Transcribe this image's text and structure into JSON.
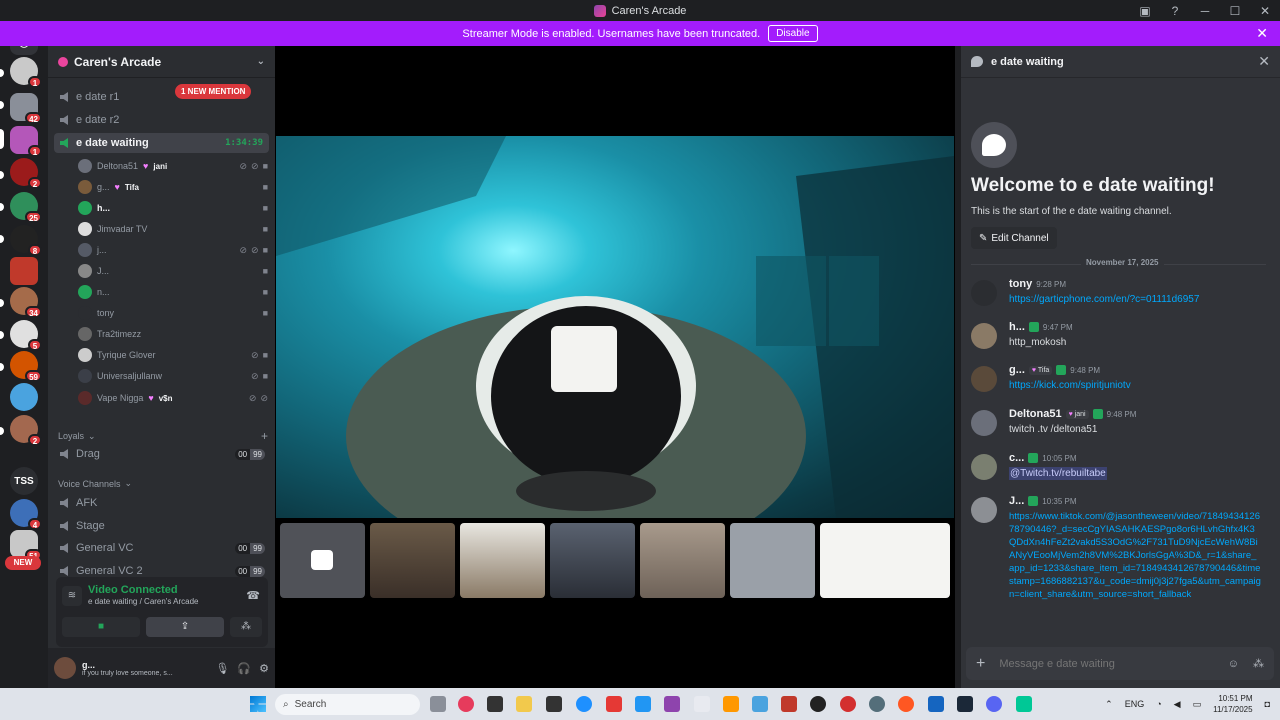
{
  "window": {
    "title": "Caren's Arcade"
  },
  "banner": {
    "text": "Streamer Mode is enabled. Usernames have been truncated.",
    "button": "Disable"
  },
  "guilds": {
    "badges": [
      "1",
      "42",
      "1",
      "2",
      "25",
      "8",
      "34",
      "5",
      "59",
      "2",
      "4",
      "51"
    ],
    "tss_label": "TSS",
    "new_label": "NEW"
  },
  "server": {
    "name": "Caren's Arcade"
  },
  "channels": {
    "r1": "e date r1",
    "mention": "1 NEW MENTION",
    "r2": "e date r2",
    "active": "e date waiting",
    "active_timer": "1:34:39"
  },
  "voice_users": [
    {
      "name": "Deltona51",
      "tag": "jani",
      "heart": true
    },
    {
      "name": "g...",
      "tag": "Tifa",
      "heart": true
    },
    {
      "name": "h...",
      "live": true
    },
    {
      "name": "Jimvadar TV"
    },
    {
      "name": "j..."
    },
    {
      "name": "J..."
    },
    {
      "name": "n..."
    },
    {
      "name": "tony"
    },
    {
      "name": "Tra2timezz"
    },
    {
      "name": "Tyrique Glover"
    },
    {
      "name": "Universaljullanw"
    },
    {
      "name": "Vape Nigga",
      "tag": "v$n",
      "heart": true
    }
  ],
  "categories": {
    "loyals": "Loyals",
    "drag": "Drag",
    "drag_count": [
      "00",
      "99"
    ],
    "voice": "Voice Channels",
    "afk": "AFK",
    "stage": "Stage",
    "general": "General VC",
    "general_count": [
      "00",
      "99"
    ],
    "general2": "General VC 2",
    "general2_count": [
      "00",
      "99"
    ]
  },
  "voice_panel": {
    "status": "Video Connected",
    "channel": "e date waiting / Caren's Arcade"
  },
  "user_panel": {
    "name": "g...",
    "status": "if you truly love someone, s..."
  },
  "chat": {
    "header": "e date waiting",
    "welcome_title": "Welcome to e date waiting!",
    "welcome_sub": "This is the start of the e date waiting channel.",
    "edit_button": "Edit Channel",
    "date_divider": "November 17, 2025",
    "messages": [
      {
        "author": "tony",
        "time": "9:28 PM",
        "body": "https://garticphone.com/en/?c=01111d6957"
      },
      {
        "author": "h...",
        "time": "9:47 PM",
        "body": "http_mokosh"
      },
      {
        "author": "g...",
        "tag": "Tifa",
        "time": "9:48 PM",
        "body": "https://kick.com/spiritjuniotv"
      },
      {
        "author": "Deltona51",
        "tag": "jani",
        "time": "9:48 PM",
        "body": "twitch .tv /deltona51"
      },
      {
        "author": "c...",
        "time": "10:05 PM",
        "body": "@Twitch.tv/rebuiltabe"
      },
      {
        "author": "J...",
        "time": "10:35 PM",
        "body": "https://www.tiktok.com/@jasontheween/video/7184943412678790446?_d=secCgYIASAHKAESPgo8or6HLvhGhfx4K3QDdXn4hFeZt2vakd5S3OdG%2F731TuD9NjcEcWehW8BiANyVEooMjVem2h8VM%2BKJorlsGgA%3D&_r=1&share_app_id=1233&share_item_id=7184943412678790446&timestamp=1686882137&u_code=dmij0j3j27fga5&utm_campaign=client_share&utm_source=short_fallback"
      }
    ],
    "composer_placeholder": "Message e date waiting"
  },
  "taskbar": {
    "search": "Search",
    "lang": "ENG",
    "time": "10:51 PM",
    "date": "11/17/2025"
  },
  "colors": {
    "accent": "#a31cfc",
    "brand": "#5865f2",
    "online": "#23a55a",
    "mention": "#da373c"
  }
}
